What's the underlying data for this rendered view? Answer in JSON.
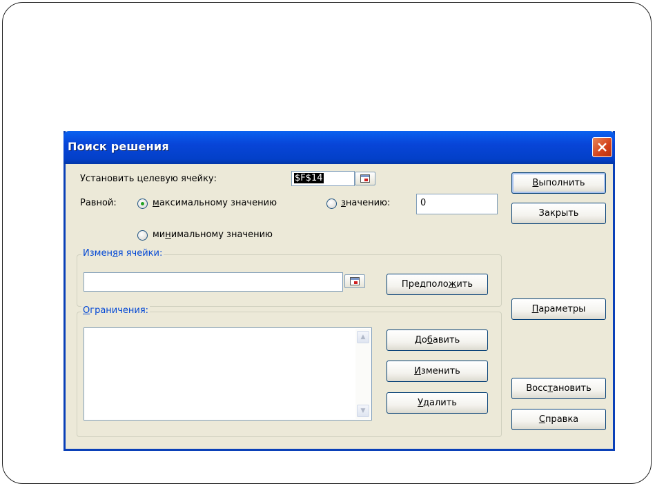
{
  "dialog": {
    "title": "Поиск решения",
    "target_cell_label": "Установить целевую ячейку:",
    "target_cell_value": "$F$14",
    "equal_label": "Равной:",
    "radio_max": {
      "prefix": "",
      "accel": "м",
      "rest": "аксимальному значению",
      "checked": true
    },
    "radio_value": {
      "prefix": "",
      "accel": "з",
      "rest": "начению:",
      "checked": false
    },
    "value_field": "0",
    "radio_min": {
      "prefix": "ми",
      "accel": "н",
      "rest": "имальному значению",
      "checked": false
    },
    "changing_cells": {
      "prefix": "Измен",
      "accel": "я",
      "rest": "я ячейки:",
      "value": ""
    },
    "constraints": {
      "prefix": "",
      "accel": "О",
      "rest": "граничения:"
    },
    "buttons": {
      "solve": {
        "prefix": "",
        "accel": "В",
        "rest": "ыполнить"
      },
      "close": {
        "prefix": "Закрыть",
        "accel": "",
        "rest": ""
      },
      "guess": {
        "prefix": "Предполо",
        "accel": "ж",
        "rest": "ить"
      },
      "options": {
        "prefix": "",
        "accel": "П",
        "rest": "араметры"
      },
      "add": {
        "prefix": "До",
        "accel": "б",
        "rest": "авить"
      },
      "change": {
        "prefix": "",
        "accel": "И",
        "rest": "зменить"
      },
      "reset": {
        "prefix": "Восс",
        "accel": "т",
        "rest": "ановить"
      },
      "delete": {
        "prefix": "",
        "accel": "У",
        "rest": "далить"
      },
      "help": {
        "prefix": "",
        "accel": "С",
        "rest": "правка"
      }
    }
  },
  "colors": {
    "titlebar": "#0845d8",
    "dialog_bg": "#ece9d8",
    "group_label": "#0046d5",
    "close": "#d3411a"
  },
  "icons": [
    "close-icon",
    "cell-picker-icon",
    "scroll-up-icon",
    "scroll-down-icon",
    "radio-selected-icon"
  ]
}
